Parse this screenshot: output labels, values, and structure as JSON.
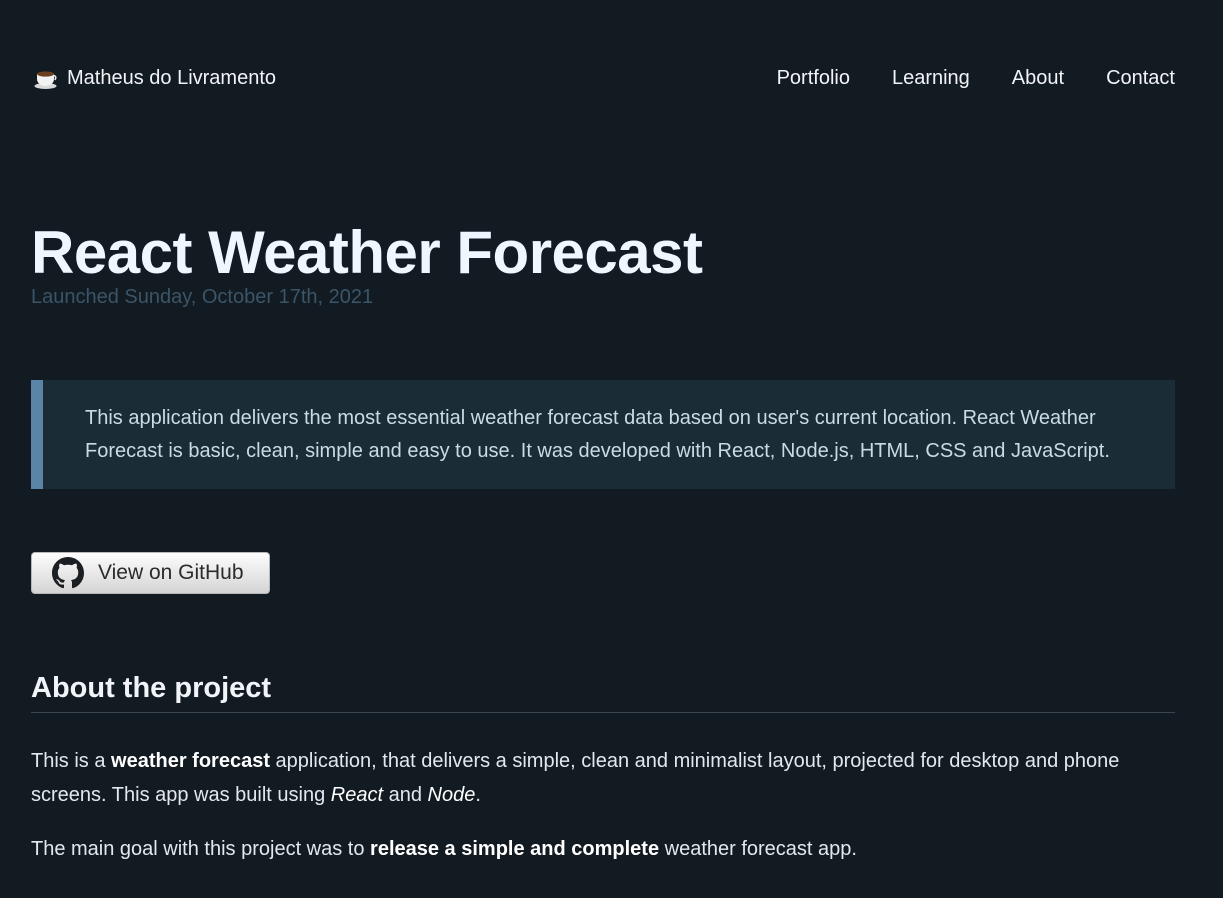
{
  "header": {
    "brand_name": "Matheus do Livramento",
    "brand_icon": "coffee-cup-icon",
    "nav": [
      {
        "label": "Portfolio"
      },
      {
        "label": "Learning"
      },
      {
        "label": "About"
      },
      {
        "label": "Contact"
      }
    ]
  },
  "project": {
    "title": "React Weather Forecast",
    "launched": "Launched Sunday, October 17th, 2021",
    "summary": "This application delivers the most essential weather forecast data based on user's current location. React Weather Forecast is basic, clean, simple and easy to use. It was developed with React, Node.js, HTML, CSS and JavaScript.",
    "github_button_label": "View on GitHub",
    "github_icon": "github-icon"
  },
  "about": {
    "heading": "About the project",
    "p1": {
      "part1": "This is a ",
      "bold1": "weather forecast",
      "part2": " application, that delivers a simple, clean and minimalist layout, projected for desktop and phone screens. This app was built using ",
      "italic1": "React",
      "part3": " and ",
      "italic2": "Node",
      "part4": "."
    },
    "p2": {
      "part1": "The main goal with this project was to ",
      "bold1": "release a simple and complete",
      "part2": " weather forecast app."
    }
  },
  "colors": {
    "background": "#121a22",
    "callout_bg": "#1a2c35",
    "callout_border": "#5b85a6",
    "launched_text": "#3b5568"
  }
}
